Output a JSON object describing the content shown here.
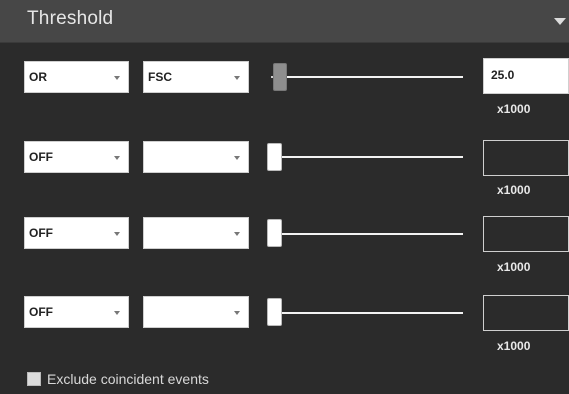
{
  "panel": {
    "title": "Threshold"
  },
  "rows": [
    {
      "logic": "OR",
      "parameter": "FSC",
      "value": "25.0",
      "unit": "x1000",
      "slider_fraction": 0.05
    },
    {
      "logic": "OFF",
      "parameter": "",
      "value": "",
      "unit": "x1000",
      "slider_fraction": 0.0
    },
    {
      "logic": "OFF",
      "parameter": "",
      "value": "",
      "unit": "x1000",
      "slider_fraction": 0.0
    },
    {
      "logic": "OFF",
      "parameter": "",
      "value": "",
      "unit": "x1000",
      "slider_fraction": 0.0
    }
  ],
  "exclude": {
    "label": "Exclude coincident events",
    "checked": false
  },
  "icons": {
    "collapse": "chevron-down-icon",
    "dropdown": "caret-down-icon"
  }
}
